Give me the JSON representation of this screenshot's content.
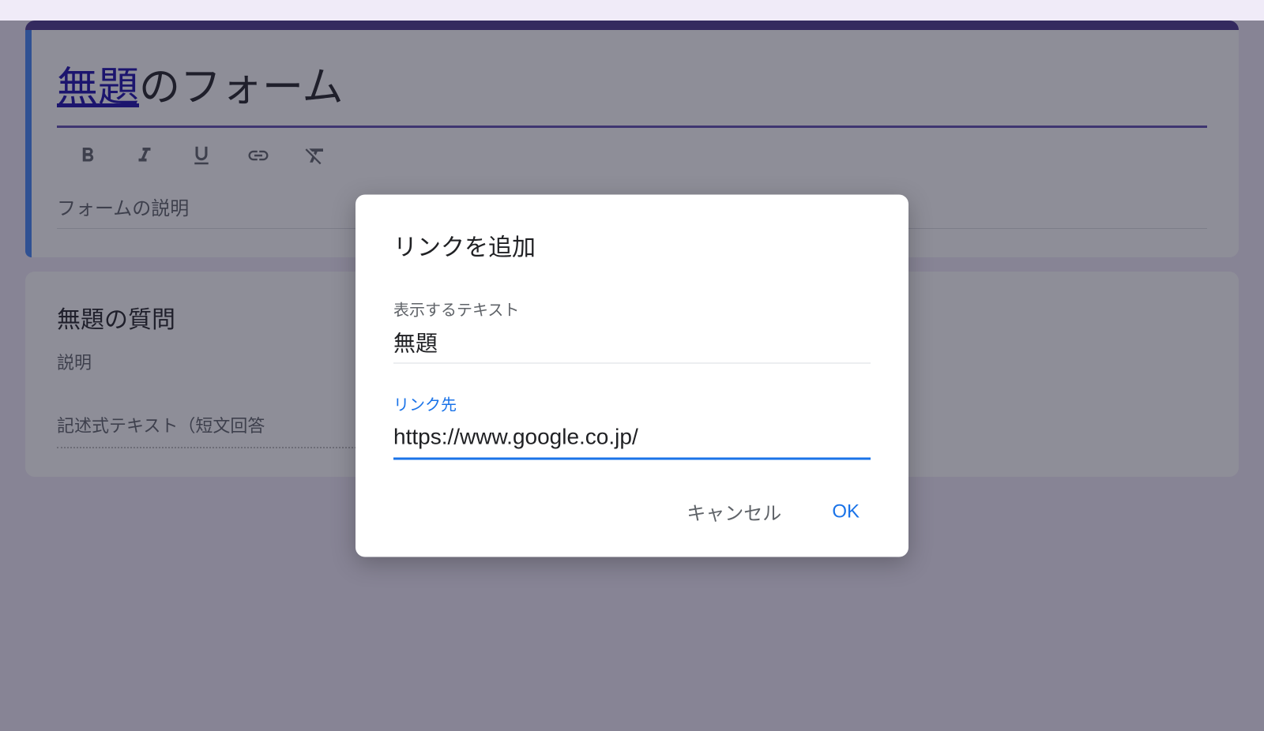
{
  "form": {
    "title_linked": "無題",
    "title_rest": "のフォーム",
    "description": "フォームの説明"
  },
  "question": {
    "title": "無題の質問",
    "description": "説明",
    "answer_hint": "記述式テキスト（短文回答"
  },
  "modal": {
    "title": "リンクを追加",
    "text_label": "表示するテキスト",
    "text_value": "無題",
    "url_label": "リンク先",
    "url_value": "https://www.google.co.jp/",
    "cancel": "キャンセル",
    "ok": "OK"
  }
}
